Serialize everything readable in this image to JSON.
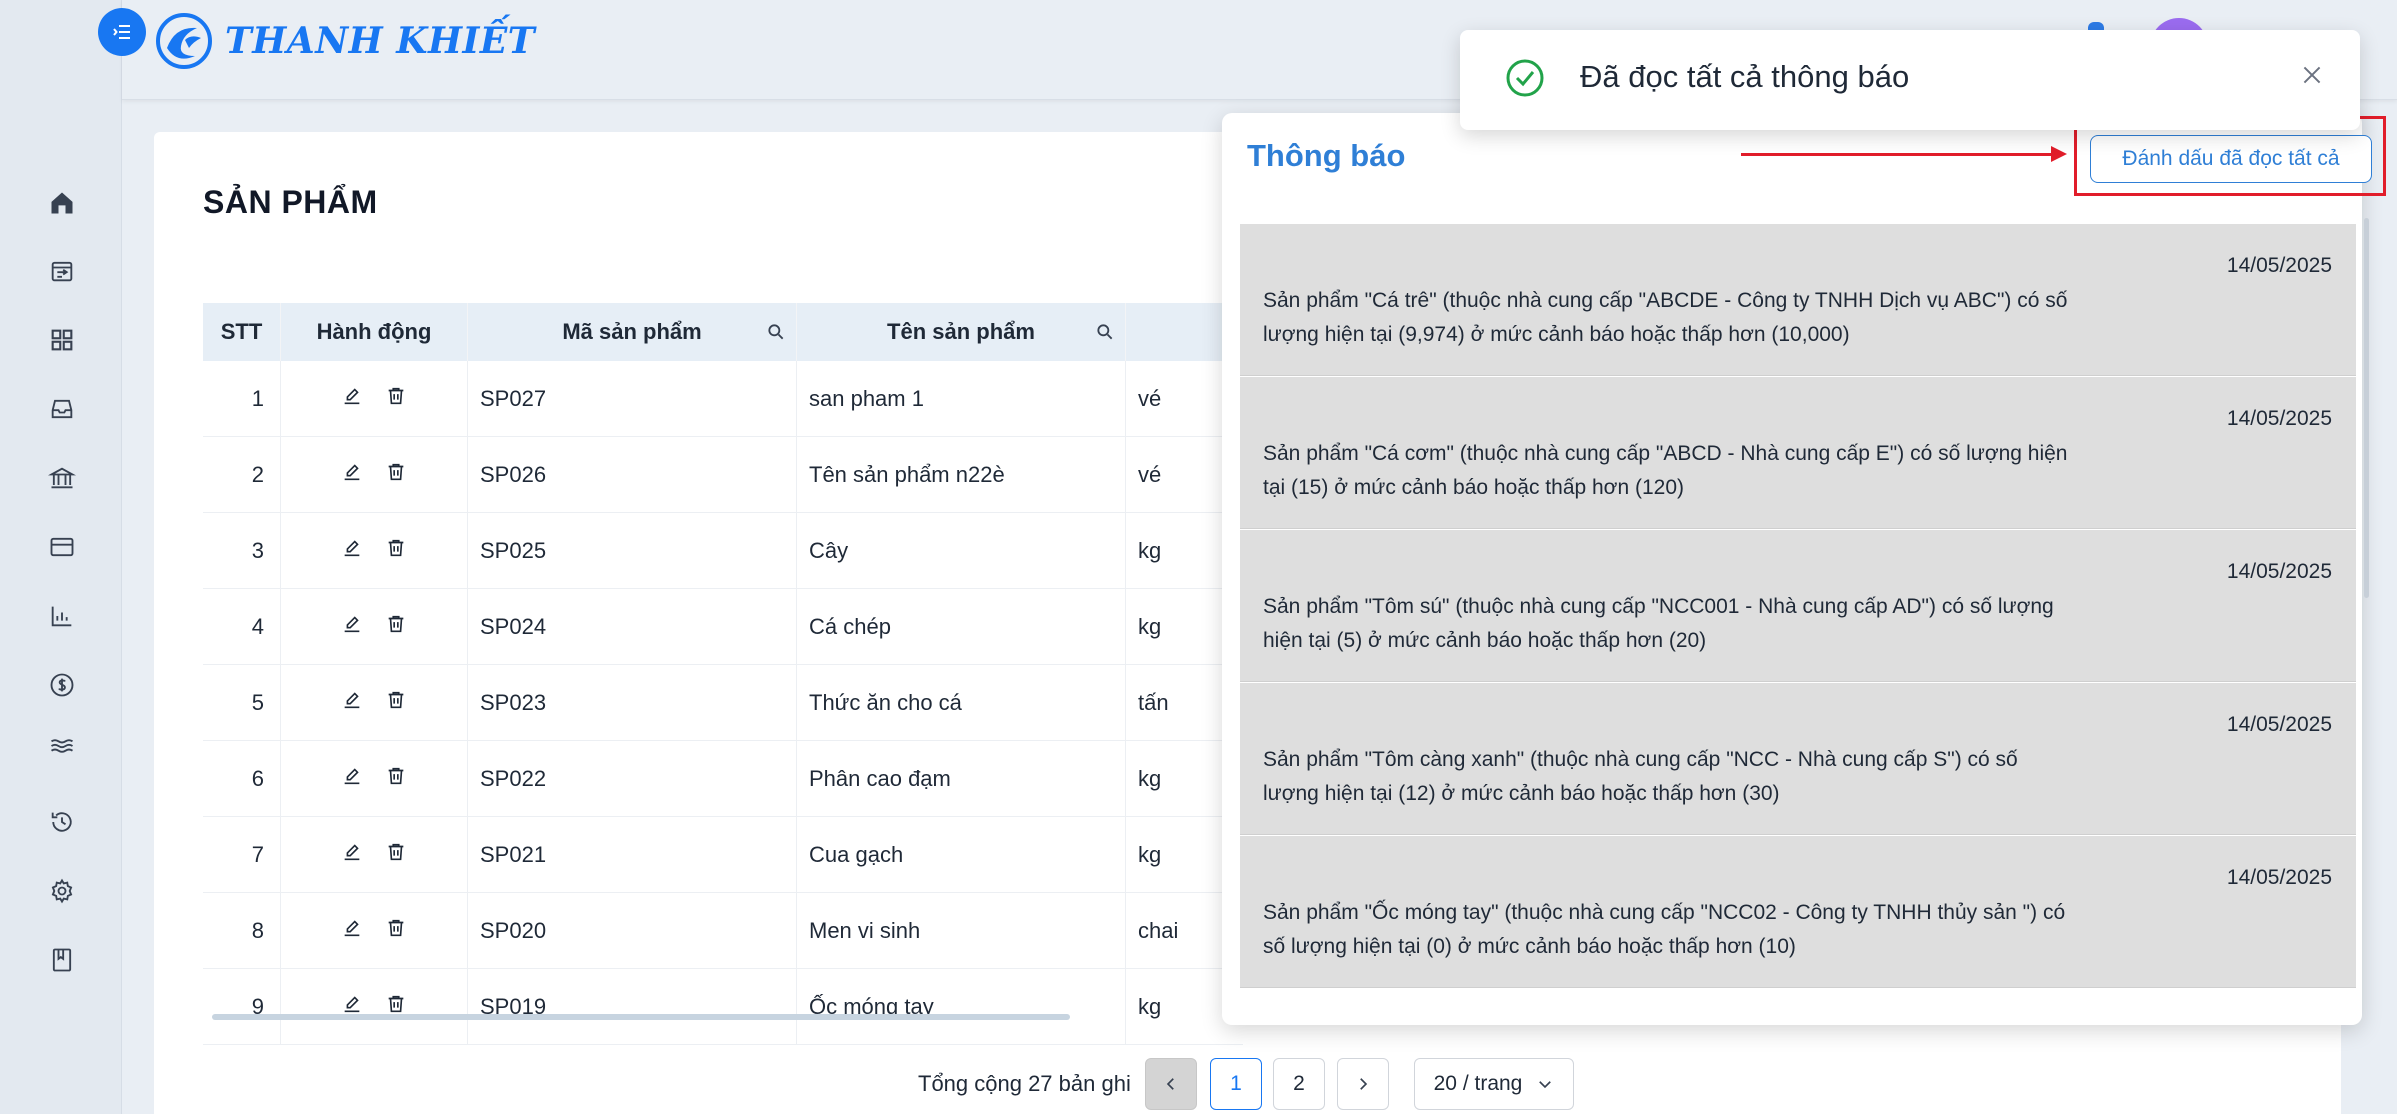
{
  "app": {
    "brand": "THANH KHIẾT"
  },
  "sidebar": {
    "items": [
      {
        "icon": "home-icon"
      },
      {
        "icon": "transfer-icon"
      },
      {
        "icon": "grid-icon"
      },
      {
        "icon": "inbox-icon"
      },
      {
        "icon": "bank-icon"
      },
      {
        "icon": "card-icon"
      },
      {
        "icon": "chart-icon"
      },
      {
        "icon": "dollar-icon"
      },
      {
        "icon": "wave-icon"
      },
      {
        "icon": "history-icon"
      },
      {
        "icon": "gear-icon"
      },
      {
        "icon": "book-icon"
      }
    ]
  },
  "page": {
    "title": "SẢN PHẨM"
  },
  "table": {
    "headers": {
      "stt": "STT",
      "actions": "Hành động",
      "code": "Mã sản phẩm",
      "name": "Tên sản phẩm"
    },
    "rows": [
      {
        "stt": "1",
        "code": "SP027",
        "name": "san pham 1",
        "unit": "vé"
      },
      {
        "stt": "2",
        "code": "SP026",
        "name": "Tên sản phẩm n22è",
        "unit": "vé"
      },
      {
        "stt": "3",
        "code": "SP025",
        "name": "Cây",
        "unit": "kg"
      },
      {
        "stt": "4",
        "code": "SP024",
        "name": "Cá chép",
        "unit": "kg"
      },
      {
        "stt": "5",
        "code": "SP023",
        "name": "Thức ăn cho cá",
        "unit": "tấn"
      },
      {
        "stt": "6",
        "code": "SP022",
        "name": "Phân cao đạm",
        "unit": "kg"
      },
      {
        "stt": "7",
        "code": "SP021",
        "name": "Cua gạch",
        "unit": "kg"
      },
      {
        "stt": "8",
        "code": "SP020",
        "name": "Men vi sinh",
        "unit": "chai"
      },
      {
        "stt": "9",
        "code": "SP019",
        "name": "Ốc móng tay",
        "unit": "kg"
      }
    ]
  },
  "pagination": {
    "total": "Tổng cộng 27 bản ghi",
    "pages": [
      "1",
      "2"
    ],
    "current": "1",
    "page_size": "20 / trang"
  },
  "notifications": {
    "title": "Thông báo",
    "mark_all_label": "Đánh dấu đã đọc tất cả",
    "items": [
      {
        "date": "14/05/2025",
        "text": "Sản phẩm \"Cá trê\" (thuộc nhà cung cấp \"ABCDE - Công ty TNHH Dịch vụ ABC\") có số lượng hiện tại (9,974) ở mức cảnh báo hoặc thấp hơn (10,000)"
      },
      {
        "date": "14/05/2025",
        "text": "Sản phẩm \"Cá cơm\" (thuộc nhà cung cấp \"ABCD - Nhà cung cấp E\") có số lượng hiện tại (15) ở mức cảnh báo hoặc thấp hơn (120)"
      },
      {
        "date": "14/05/2025",
        "text": "Sản phẩm \"Tôm sú\" (thuộc nhà cung cấp \"NCC001 - Nhà cung cấp AD\") có số lượng hiện tại (5) ở mức cảnh báo hoặc thấp hơn (20)"
      },
      {
        "date": "14/05/2025",
        "text": "Sản phẩm \"Tôm càng xanh\" (thuộc nhà cung cấp \"NCC - Nhà cung cấp S\") có số lượng hiện tại (12) ở mức cảnh báo hoặc thấp hơn (30)"
      },
      {
        "date": "14/05/2025",
        "text": "Sản phẩm \"Ốc móng tay\" (thuộc nhà cung cấp \"NCC02 - Công ty TNHH thủy sản \") có số lượng hiện tại (0) ở mức cảnh báo hoặc thấp hơn (10)"
      }
    ]
  },
  "toast": {
    "message": "Đã đọc tất cả thông báo"
  },
  "colors": {
    "accent": "#1877f2",
    "panel_title": "#2f7fd6",
    "highlight": "#e11d2a",
    "success": "#22a34a"
  }
}
